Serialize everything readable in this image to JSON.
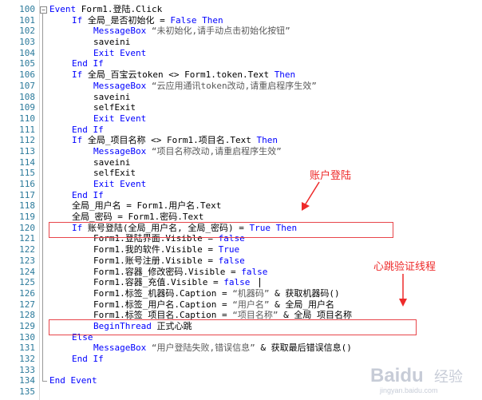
{
  "editor": {
    "lines": [
      {
        "num": "100",
        "indent": 0,
        "tokens": [
          [
            "kw",
            "Event "
          ],
          [
            "txt",
            "Form1.登陆.Click"
          ]
        ],
        "fold": "open"
      },
      {
        "num": "101",
        "indent": 1,
        "tokens": [
          [
            "kw",
            "If "
          ],
          [
            "txt",
            "全局_是否初始化 = "
          ],
          [
            "kw",
            "False Then"
          ]
        ]
      },
      {
        "num": "102",
        "indent": 2,
        "tokens": [
          [
            "fn",
            "MessageBox "
          ],
          [
            "str",
            "“未初始化,请手动点击初始化按钮”"
          ]
        ]
      },
      {
        "num": "103",
        "indent": 2,
        "tokens": [
          [
            "txt",
            "saveini"
          ]
        ]
      },
      {
        "num": "104",
        "indent": 2,
        "tokens": [
          [
            "kw",
            "Exit Event"
          ]
        ]
      },
      {
        "num": "105",
        "indent": 1,
        "tokens": [
          [
            "kw",
            "End If"
          ]
        ]
      },
      {
        "num": "106",
        "indent": 1,
        "tokens": [
          [
            "kw",
            "If "
          ],
          [
            "txt",
            "全局_百宝云token <> Form1.token.Text "
          ],
          [
            "kw",
            "Then"
          ]
        ]
      },
      {
        "num": "107",
        "indent": 2,
        "tokens": [
          [
            "fn",
            "MessageBox "
          ],
          [
            "str",
            "“云应用通讯token改动,请重启程序生效”"
          ]
        ]
      },
      {
        "num": "108",
        "indent": 2,
        "tokens": [
          [
            "txt",
            "saveini"
          ]
        ]
      },
      {
        "num": "109",
        "indent": 2,
        "tokens": [
          [
            "txt",
            "selfExit"
          ]
        ]
      },
      {
        "num": "110",
        "indent": 2,
        "tokens": [
          [
            "kw",
            "Exit Event"
          ]
        ]
      },
      {
        "num": "111",
        "indent": 1,
        "tokens": [
          [
            "kw",
            "End If"
          ]
        ]
      },
      {
        "num": "112",
        "indent": 1,
        "tokens": [
          [
            "kw",
            "If "
          ],
          [
            "txt",
            "全局_项目名称 <> Form1.项目名.Text "
          ],
          [
            "kw",
            "Then"
          ]
        ]
      },
      {
        "num": "113",
        "indent": 2,
        "tokens": [
          [
            "fn",
            "MessageBox "
          ],
          [
            "str",
            "“项目名称改动,请重启程序生效”"
          ]
        ]
      },
      {
        "num": "114",
        "indent": 2,
        "tokens": [
          [
            "txt",
            "saveini"
          ]
        ]
      },
      {
        "num": "115",
        "indent": 2,
        "tokens": [
          [
            "txt",
            "selfExit"
          ]
        ]
      },
      {
        "num": "116",
        "indent": 2,
        "tokens": [
          [
            "kw",
            "Exit Event"
          ]
        ]
      },
      {
        "num": "117",
        "indent": 1,
        "tokens": [
          [
            "kw",
            "End If"
          ]
        ]
      },
      {
        "num": "118",
        "indent": 1,
        "tokens": [
          [
            "txt",
            "全局_用户名 = Form1.用户名.Text"
          ]
        ]
      },
      {
        "num": "119",
        "indent": 1,
        "tokens": [
          [
            "txt",
            "全局_密码 = Form1.密码.Text"
          ]
        ]
      },
      {
        "num": "120",
        "indent": 1,
        "tokens": [
          [
            "kw",
            "If "
          ],
          [
            "txt",
            "账号登陆(全局_用户名, 全局_密码) = "
          ],
          [
            "kw",
            "True Then"
          ]
        ]
      },
      {
        "num": "121",
        "indent": 2,
        "tokens": [
          [
            "txt",
            "Form1.登陆界面.Visible = "
          ],
          [
            "kw",
            "false"
          ]
        ]
      },
      {
        "num": "122",
        "indent": 2,
        "tokens": [
          [
            "txt",
            "Form1.我的软件.Visible = "
          ],
          [
            "kw",
            "True"
          ]
        ]
      },
      {
        "num": "123",
        "indent": 2,
        "tokens": [
          [
            "txt",
            "Form1.账号注册.Visible = "
          ],
          [
            "kw",
            "false"
          ]
        ]
      },
      {
        "num": "124",
        "indent": 2,
        "tokens": [
          [
            "txt",
            "Form1.容器_修改密码.Visible = "
          ],
          [
            "kw",
            "false"
          ]
        ]
      },
      {
        "num": "125",
        "indent": 2,
        "tokens": [
          [
            "txt",
            "Form1.容器_充值.Visible = "
          ],
          [
            "kw",
            "false"
          ]
        ]
      },
      {
        "num": "126",
        "indent": 2,
        "tokens": [
          [
            "txt",
            "Form1.标签_机器码.Caption = "
          ],
          [
            "str",
            "“机器码” "
          ],
          [
            "txt",
            "& 获取机器码()"
          ]
        ]
      },
      {
        "num": "127",
        "indent": 2,
        "tokens": [
          [
            "txt",
            "Form1.标签_用户名.Caption = "
          ],
          [
            "str",
            "“用户名” "
          ],
          [
            "txt",
            "& 全局_用户名"
          ]
        ]
      },
      {
        "num": "128",
        "indent": 2,
        "tokens": [
          [
            "txt",
            "Form1.标签_项目名.Caption = "
          ],
          [
            "str",
            "“项目名称” "
          ],
          [
            "txt",
            "& 全局_项目名称"
          ]
        ]
      },
      {
        "num": "129",
        "indent": 2,
        "tokens": [
          [
            "kw",
            "BeginThread "
          ],
          [
            "txt",
            "正式心跳"
          ]
        ]
      },
      {
        "num": "130",
        "indent": 1,
        "tokens": [
          [
            "kw",
            "Else"
          ]
        ]
      },
      {
        "num": "131",
        "indent": 2,
        "tokens": [
          [
            "fn",
            "MessageBox "
          ],
          [
            "str",
            "“用户登陆失败,错误信息” "
          ],
          [
            "txt",
            "& 获取最后错误信息()"
          ]
        ]
      },
      {
        "num": "132",
        "indent": 1,
        "tokens": [
          [
            "kw",
            "End If"
          ]
        ]
      },
      {
        "num": "133",
        "indent": 0,
        "tokens": []
      },
      {
        "num": "134",
        "indent": 0,
        "tokens": [
          [
            "kw",
            "End Event"
          ]
        ],
        "fold": "end"
      },
      {
        "num": "135",
        "indent": 0,
        "tokens": []
      }
    ]
  },
  "annotations": {
    "account_login": "账户登陆",
    "heartbeat": "心跳验证线程"
  },
  "colors": {
    "keyword": "#0000ff",
    "string": "#595959",
    "line_number": "#2b7a9b",
    "annotation": "#ee2a2a"
  },
  "watermark": {
    "brand": "Baidu",
    "suffix": "经验",
    "url": "jingyan.baidu.com"
  }
}
